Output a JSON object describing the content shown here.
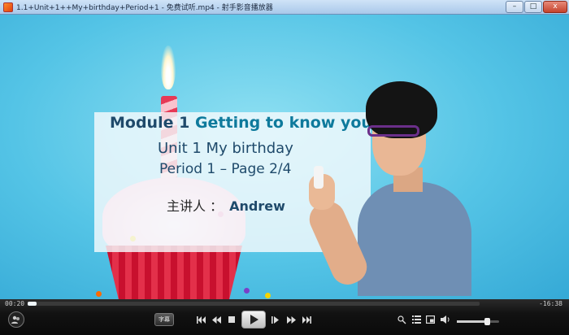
{
  "window": {
    "title": "1.1+Unit+1++My+birthday+Period+1 - 免费试听.mp4 - 射手影音播放器",
    "minimize_glyph": "–",
    "maximize_glyph": "□",
    "close_glyph": "x"
  },
  "slide": {
    "line1_a": "Module 1",
    "line1_b": "Getting to know you",
    "line2": "Unit 1 My birthday",
    "line3": "Period 1 – Page 2/4",
    "presenter_label": "主讲人 ：",
    "presenter_name": "Andrew"
  },
  "player": {
    "elapsed": "00:20",
    "remaining": "-16:38",
    "progress": 0.02,
    "buffered": 0.02,
    "volume": 0.72,
    "subtitle_label": "字幕",
    "icons": {
      "user": "user-icon",
      "prev": "skip-previous-icon",
      "rewind": "rewind-icon",
      "stop": "stop-icon",
      "play": "play-icon",
      "step": "step-forward-icon",
      "fast_forward": "fast-forward-icon",
      "next": "skip-next-icon",
      "screenshot": "screenshot-icon",
      "playlist": "playlist-icon",
      "mini_mode": "mini-mode-icon",
      "volume": "volume-icon"
    }
  }
}
